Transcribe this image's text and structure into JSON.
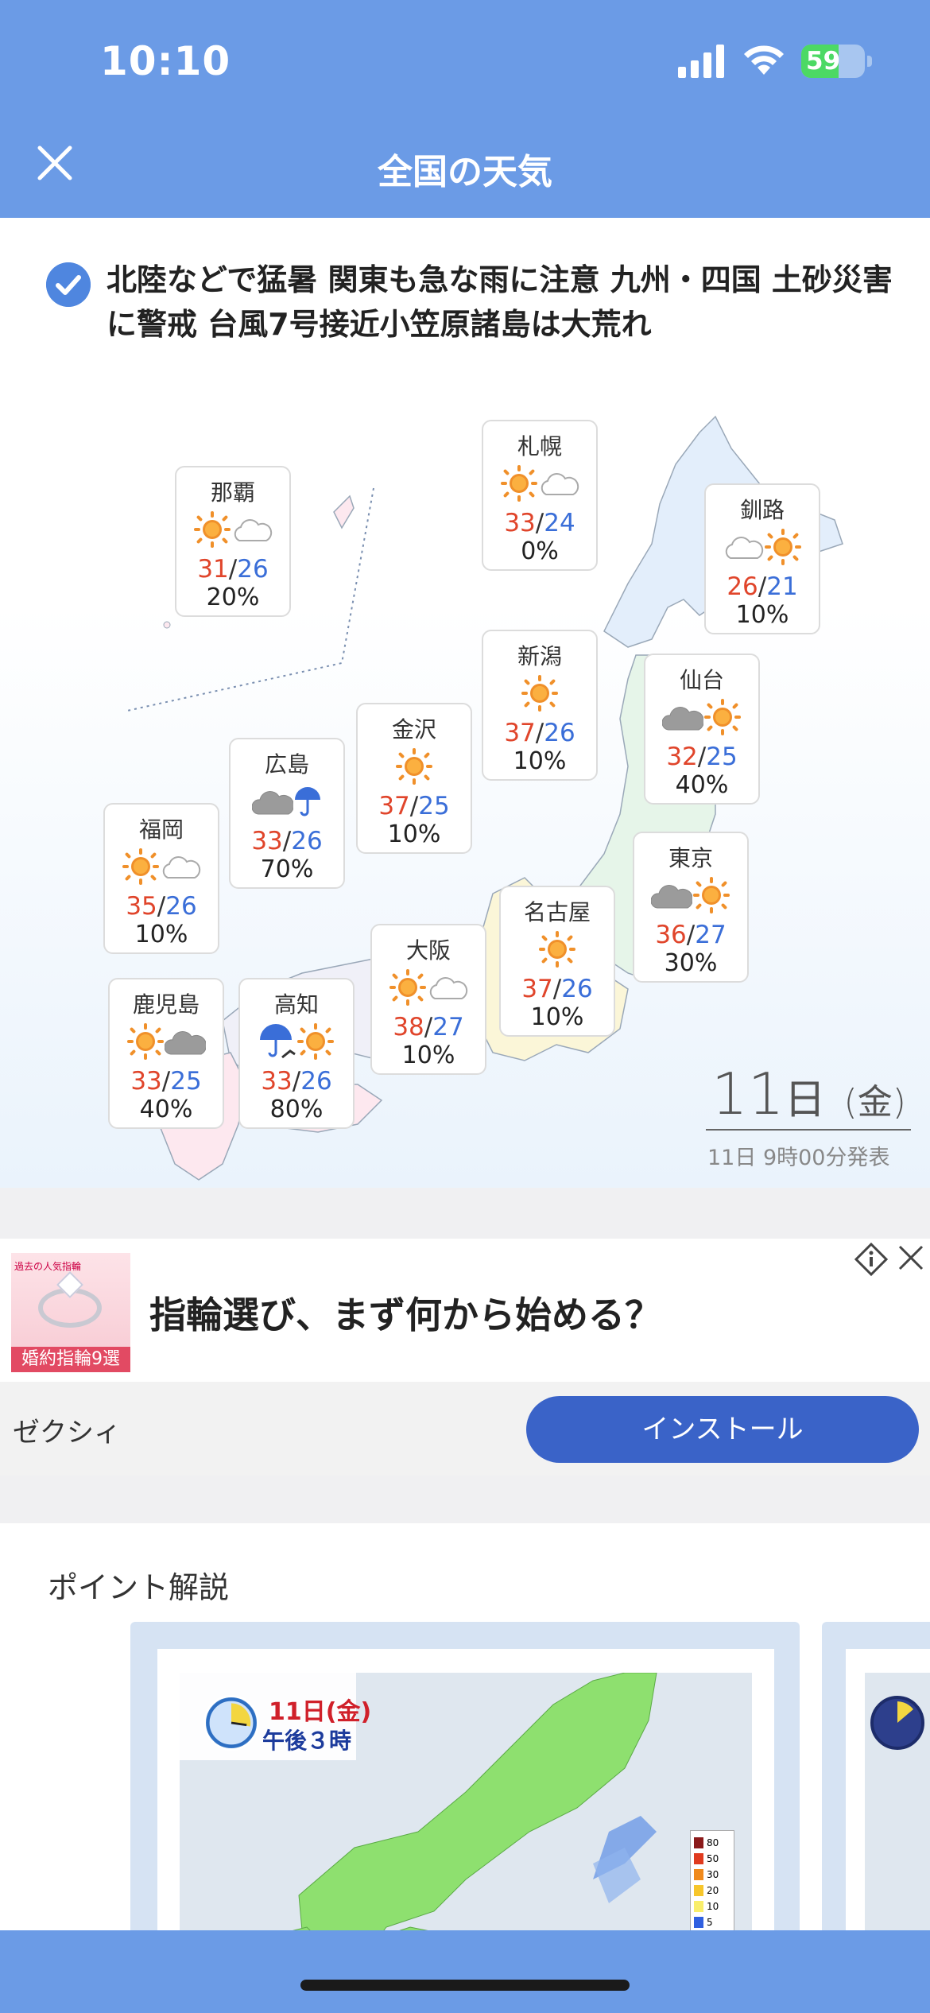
{
  "status_bar": {
    "time": "10:10",
    "battery": "59",
    "battery_level": 0.59,
    "colors": {
      "bar": "#6b9be6",
      "battery_fill": "#4cd964"
    }
  },
  "header": {
    "title": "全国の天気",
    "close_icon": "close-icon"
  },
  "headline": {
    "text": "北陸などで猛暑 関東も急な雨に注意 九州・四国 土砂災害に警戒 台風7号接近小笠原諸島は大荒れ"
  },
  "forecast": {
    "cities": [
      {
        "name": "札幌",
        "icons": [
          "sun-icon",
          "cloud-icon"
        ],
        "high": "33",
        "low": "24",
        "rain": "0%"
      },
      {
        "name": "那覇",
        "icons": [
          "sun-icon",
          "cloud-icon"
        ],
        "high": "31",
        "low": "26",
        "rain": "20%"
      },
      {
        "name": "釧路",
        "icons": [
          "cloud-icon",
          "sun-icon"
        ],
        "high": "26",
        "low": "21",
        "rain": "10%"
      },
      {
        "name": "新潟",
        "icons": [
          "sun-icon"
        ],
        "high": "37",
        "low": "26",
        "rain": "10%"
      },
      {
        "name": "仙台",
        "icons": [
          "cloud-icon",
          "sun-icon"
        ],
        "high": "32",
        "low": "25",
        "rain": "40%"
      },
      {
        "name": "金沢",
        "icons": [
          "sun-icon"
        ],
        "high": "37",
        "low": "25",
        "rain": "10%"
      },
      {
        "name": "広島",
        "icons": [
          "cloud-icon",
          "umbrella-icon"
        ],
        "high": "33",
        "low": "26",
        "rain": "70%"
      },
      {
        "name": "福岡",
        "icons": [
          "sun-icon",
          "cloud-icon"
        ],
        "high": "35",
        "low": "26",
        "rain": "10%"
      },
      {
        "name": "東京",
        "icons": [
          "cloud-icon",
          "sun-icon"
        ],
        "high": "36",
        "low": "27",
        "rain": "30%"
      },
      {
        "name": "名古屋",
        "icons": [
          "sun-icon"
        ],
        "high": "37",
        "low": "26",
        "rain": "10%"
      },
      {
        "name": "大阪",
        "icons": [
          "sun-icon",
          "cloud-icon"
        ],
        "high": "38",
        "low": "27",
        "rain": "10%"
      },
      {
        "name": "鹿児島",
        "icons": [
          "sun-icon",
          "cloud-icon"
        ],
        "high": "33",
        "low": "25",
        "rain": "40%"
      },
      {
        "name": "高知",
        "icons": [
          "umbrella-icon",
          "sun-icon"
        ],
        "high": "33",
        "low": "26",
        "rain": "80%"
      }
    ],
    "date_num": "11",
    "date_day": "日",
    "date_weekday": "(金)",
    "issued": "11日 9時00分発表"
  },
  "ad": {
    "thumb_tag": "婚約指輪9選",
    "thumb_small": "過去の人気指輪",
    "title": "指輪選び、まず何から始める？",
    "advertiser": "ゼクシィ",
    "install_label": "インストール"
  },
  "point": {
    "title": "ポイント解説",
    "radar_date": "11日(金)",
    "radar_time": "午後３時",
    "legend": [
      "80",
      "50",
      "30",
      "20",
      "10",
      "5"
    ]
  }
}
